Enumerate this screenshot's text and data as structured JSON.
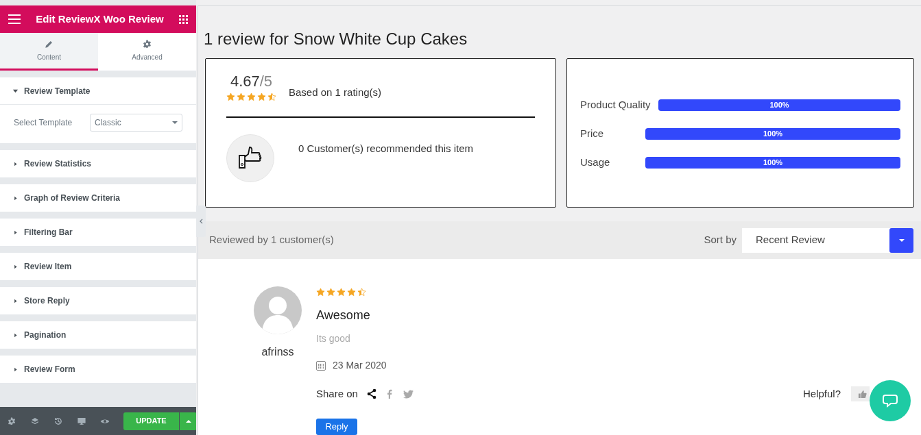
{
  "editor": {
    "title": "Edit ReviewX Woo Review",
    "tabs": [
      {
        "label": "Content",
        "selected": true
      },
      {
        "label": "Advanced",
        "selected": false
      }
    ],
    "sections": [
      {
        "title": "Review Template",
        "expanded": true,
        "field": {
          "label": "Select Template",
          "value": "Classic"
        }
      },
      {
        "title": "Review Statistics",
        "expanded": false
      },
      {
        "title": "Graph of Review Criteria",
        "expanded": false
      },
      {
        "title": "Filtering Bar",
        "expanded": false
      },
      {
        "title": "Review Item",
        "expanded": false
      },
      {
        "title": "Store Reply",
        "expanded": false
      },
      {
        "title": "Pagination",
        "expanded": false
      },
      {
        "title": "Review Form",
        "expanded": false
      }
    ],
    "footer": {
      "update_button": "UPDATE"
    }
  },
  "preview": {
    "heading": "1 review for Snow White Cup Cakes",
    "summary": {
      "score": "4.67",
      "out_of": "/5",
      "stars": 4.5,
      "based_on": "Based on 1 rating(s)",
      "recommended": "0 Customer(s) recommended this item"
    },
    "criteria": [
      {
        "label": "Product Quality",
        "level": 1,
        "reading": "100%"
      },
      {
        "label": "Price",
        "level": 1,
        "reading": "100%"
      },
      {
        "label": "Usage",
        "level": 1,
        "reading": "100%"
      }
    ],
    "filter_bar": {
      "count": "Reviewed by 1 customer(s)",
      "sort_label": "Sort by",
      "sort_value": "Recent Review"
    },
    "reviews": [
      {
        "author": "afrinss",
        "stars": 4.5,
        "title": "Awesome",
        "body": "Its good",
        "date": "23 Mar 2020",
        "share_label": "Share on",
        "helpful_label": "Helpful?",
        "reply_button": "Reply"
      }
    ]
  }
}
